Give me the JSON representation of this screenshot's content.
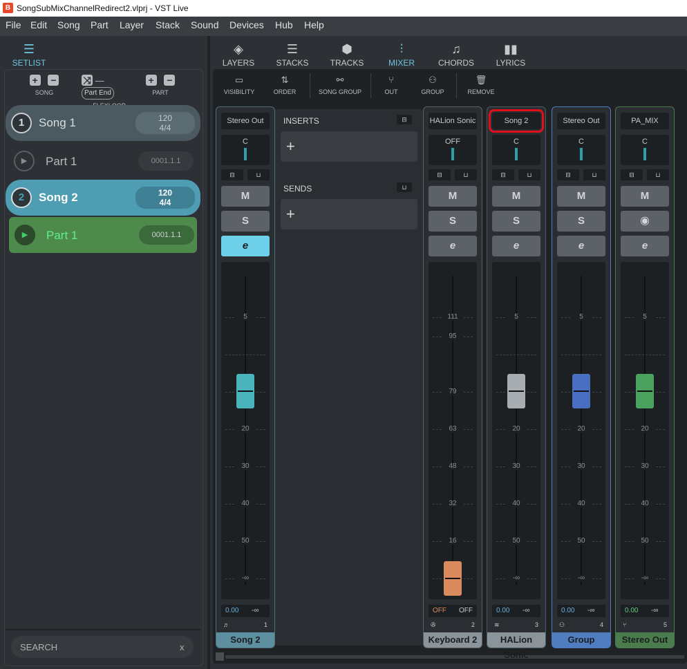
{
  "window": {
    "title": "SongSubMixChannelRedirect2.vlprj - VST Live",
    "icon_letter": "B"
  },
  "menu": [
    "File",
    "Edit",
    "Song",
    "Part",
    "Layer",
    "Stack",
    "Sound",
    "Devices",
    "Hub",
    "Help"
  ],
  "left": {
    "setlist_label": "SETLIST",
    "tools": {
      "song": "SONG",
      "flexloop": "FLEXLOOP",
      "part": "PART",
      "part_end": "Part End"
    },
    "songs": [
      {
        "num": "1",
        "name": "Song 1",
        "tempo": "120",
        "sig": "4/4",
        "part": "Part  1",
        "pos": "0001.1.1"
      },
      {
        "num": "2",
        "name": "Song 2",
        "tempo": "120",
        "sig": "4/4",
        "part": "Part  1",
        "pos": "0001.1.1"
      }
    ],
    "search_placeholder": "SEARCH",
    "search_clear": "x"
  },
  "tabs": [
    "LAYERS",
    "STACKS",
    "TRACKS",
    "MIXER",
    "CHORDS",
    "LYRICS"
  ],
  "active_tab": "MIXER",
  "toolbar": [
    "VISIBILITY",
    "ORDER",
    "SONG GROUP",
    "OUT",
    "GROUP",
    "REMOVE"
  ],
  "panel": {
    "inserts": "INSERTS",
    "sends": "SENDS",
    "add": "+"
  },
  "strips": [
    {
      "route": "Stereo Out",
      "pan": "C",
      "m": "M",
      "s": "S",
      "e": "e",
      "scale": [
        "5",
        "",
        "10",
        "20",
        "30",
        "40",
        "50",
        "-∞"
      ],
      "vol": "0.00",
      "peak": "-∞",
      "num": "1",
      "name": "Song 2",
      "knob_color": "#4ab3bc",
      "knob_level": 0.78,
      "name_bg": "#5e8fa0",
      "e_active": true
    },
    {
      "route": "HALion Sonic",
      "pan": "OFF",
      "m": "M",
      "s": "S",
      "e": "e",
      "scale": [
        "111",
        "95",
        "79",
        "63",
        "48",
        "32",
        "16",
        "-∞"
      ],
      "vol": "OFF",
      "peak": "OFF",
      "num": "2",
      "name": "Keyboard 2",
      "knob_color": "#d98b5e",
      "knob_level": 0.0,
      "name_bg": "#8b949b",
      "e_active": false
    },
    {
      "route": "Song 2",
      "pan": "C",
      "m": "M",
      "s": "S",
      "e": "e",
      "scale": [
        "5",
        "",
        "10",
        "20",
        "30",
        "40",
        "50",
        "-∞"
      ],
      "vol": "0.00",
      "peak": "-∞",
      "num": "3",
      "name": "HALion Sonic",
      "knob_color": "#a8adb1",
      "knob_level": 0.78,
      "name_bg": "#8b949b",
      "e_active": false
    },
    {
      "route": "Stereo Out",
      "pan": "C",
      "m": "M",
      "s": "S",
      "e": "e",
      "scale": [
        "5",
        "",
        "10",
        "20",
        "30",
        "40",
        "50",
        "-∞"
      ],
      "vol": "0.00",
      "peak": "-∞",
      "num": "4",
      "name": "Group",
      "knob_color": "#4a6ec0",
      "knob_level": 0.78,
      "name_bg": "#4f7dc0",
      "e_active": false
    },
    {
      "route": "PA_MIX",
      "pan": "C",
      "m": "M",
      "s": "S",
      "e": "e",
      "scale": [
        "5",
        "",
        "10",
        "20",
        "30",
        "40",
        "50",
        "-∞"
      ],
      "vol": "0.00",
      "peak": "-∞",
      "num": "5",
      "name": "Stereo Out",
      "knob_color": "#4aa25e",
      "knob_level": 0.78,
      "name_bg": "#4a7c4e",
      "e_active": false
    }
  ]
}
